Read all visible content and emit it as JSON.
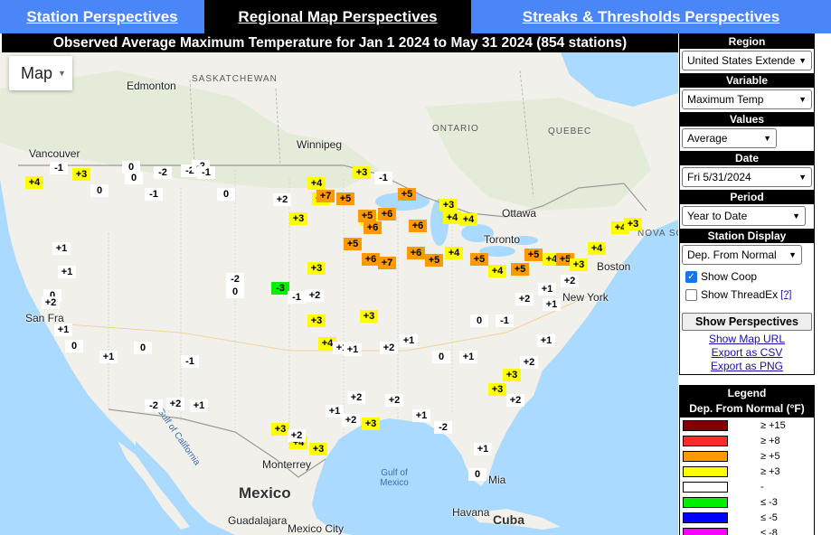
{
  "nav": {
    "station": "Station Perspectives",
    "regional": "Regional Map Perspectives",
    "streaks": "Streaks & Thresholds Perspectives"
  },
  "title": "Observed Average Maximum Temperature for Jan 1 2024 to May 31 2024 (854 stations)",
  "map": {
    "type_button": "Map",
    "regions": [
      "SASKATCHEWAN",
      "ONTARIO",
      "QUEBEC"
    ],
    "cities": [
      "Edmonton",
      "Vancouver",
      "Winnipeg",
      "Ottawa",
      "Toronto",
      "Boston",
      "New York",
      "San Fra",
      "Monterrey",
      "Guadalajara",
      "Mexico City",
      "Havana",
      "Mia"
    ],
    "countries": [
      "Mexico",
      "Cuba"
    ],
    "water": [
      "Gulf of California",
      "Gulf of Mexico",
      "NOVA SCO"
    ]
  },
  "panel": {
    "region": {
      "label": "Region",
      "value": "United States Extended"
    },
    "variable": {
      "label": "Variable",
      "value": "Maximum Temp"
    },
    "values": {
      "label": "Values",
      "value": "Average"
    },
    "date": {
      "label": "Date",
      "value": "Fri 5/31/2024"
    },
    "period": {
      "label": "Period",
      "value": "Year to Date"
    },
    "display": {
      "label": "Station Display",
      "value": "Dep. From Normal"
    },
    "show_coop": "Show Coop",
    "show_threadex": "Show ThreadEx",
    "help": "[?]",
    "show_button": "Show Perspectives",
    "links": [
      "Show Map URL",
      "Export as CSV",
      "Export as PNG"
    ]
  },
  "legend": {
    "title": "Legend",
    "subtitle": "Dep. From Normal (°F)",
    "items": [
      {
        "label": "≥ +15",
        "color": "#800000"
      },
      {
        "label": "≥ +8",
        "color": "#ff2a2a"
      },
      {
        "label": "≥ +5",
        "color": "#ff9900"
      },
      {
        "label": "≥ +3",
        "color": "#ffff00"
      },
      {
        "label": "-",
        "color": "#ffffff"
      },
      {
        "label": "≤ -3",
        "color": "#00ee00"
      },
      {
        "label": "≤ -5",
        "color": "#0000ff"
      },
      {
        "label": "≤ -8",
        "color": "#ff00ff"
      }
    ]
  },
  "station_marks": [
    "+4",
    "+3",
    "-1",
    "0",
    "-2",
    "-2",
    "-2",
    "-1",
    "0",
    "0",
    "-1",
    "0",
    "+4",
    "+3",
    "-1",
    "+4",
    "+7",
    "+5",
    "+2",
    "+3",
    "+4",
    "+5",
    "+3",
    "+6",
    "+6",
    "+5",
    "+6",
    "+4",
    "+4",
    "+5",
    "+6",
    "+7",
    "+6",
    "+5",
    "+4",
    "+5",
    "+4",
    "+5",
    "+5",
    "+4",
    "+5",
    "+3",
    "+4",
    "+4",
    "+3",
    "+2",
    "+1",
    "+2",
    "+3",
    "+3",
    "+4",
    "+3",
    "+2",
    "+1",
    "0",
    "+1",
    "+3",
    "+3",
    "+2",
    "+2",
    "+1",
    "+1",
    "0",
    "-1",
    "-2",
    "0",
    "-3",
    "-1",
    "+2",
    "+1",
    "+1",
    "+2",
    "+3",
    "+4",
    "+3",
    "+2",
    "+1",
    "0",
    "-2",
    "+1",
    "+2",
    "+3",
    "+2",
    "+1",
    "+1",
    "+1",
    "0",
    "+2",
    "+1",
    "0",
    "+1",
    "0",
    "-1",
    "-2",
    "+2",
    "+1"
  ]
}
